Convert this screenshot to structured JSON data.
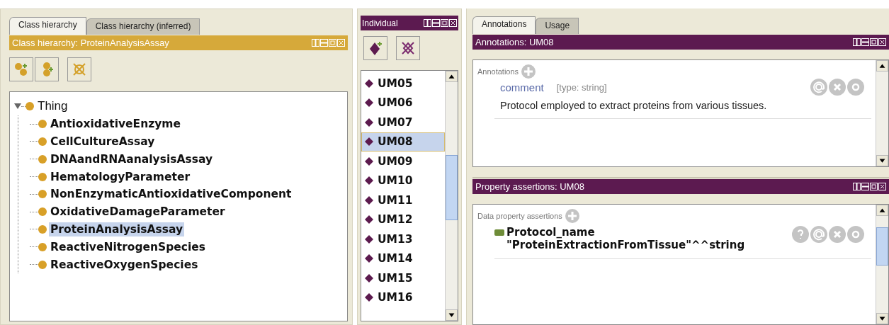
{
  "class_panel": {
    "tabs": [
      {
        "label": "Class hierarchy",
        "selected": true
      },
      {
        "label": "Class hierarchy (inferred)",
        "selected": false
      }
    ],
    "title": "Class hierarchy: ProteinAnalysisAssay",
    "tree": [
      {
        "label": "Thing",
        "expanded": true,
        "selected": false,
        "children": [
          {
            "label": "AntioxidativeEnzyme",
            "selected": false
          },
          {
            "label": "CellCultureAssay",
            "selected": false
          },
          {
            "label": "DNAandRNAanalysisAssay",
            "selected": false
          },
          {
            "label": "HematologyParameter",
            "selected": false
          },
          {
            "label": "NonEnzymaticAntioxidativeComponent",
            "selected": false
          },
          {
            "label": "OxidativeDamageParameter",
            "selected": false
          },
          {
            "label": "ProteinAnalysisAssay",
            "selected": true
          },
          {
            "label": "ReactiveNitrogenSpecies",
            "selected": false
          },
          {
            "label": "ReactiveOxygenSpecies",
            "selected": false
          }
        ]
      }
    ]
  },
  "individuals_panel": {
    "title": "Individual",
    "items": [
      {
        "label": "UM05",
        "selected": false
      },
      {
        "label": "UM06",
        "selected": false
      },
      {
        "label": "UM07",
        "selected": false
      },
      {
        "label": "UM08",
        "selected": true
      },
      {
        "label": "UM09",
        "selected": false
      },
      {
        "label": "UM10",
        "selected": false
      },
      {
        "label": "UM11",
        "selected": false
      },
      {
        "label": "UM12",
        "selected": false
      },
      {
        "label": "UM13",
        "selected": false
      },
      {
        "label": "UM14",
        "selected": false
      },
      {
        "label": "UM15",
        "selected": false
      },
      {
        "label": "UM16",
        "selected": false
      }
    ]
  },
  "details": {
    "tabs": [
      {
        "label": "Annotations",
        "selected": true
      },
      {
        "label": "Usage",
        "selected": false
      }
    ],
    "annotations": {
      "title": "Annotations: UM08",
      "section": "Annotations",
      "entries": [
        {
          "property": "comment",
          "type": "[type: string]",
          "value": "Protocol employed to extract proteins from various tissues."
        }
      ]
    },
    "property_assertions": {
      "title": "Property assertions: UM08",
      "section": "Data property assertions",
      "entries": [
        {
          "property": "Protocol_name",
          "value": "\"ProteinExtractionFromTissue\"^^string"
        }
      ]
    }
  }
}
